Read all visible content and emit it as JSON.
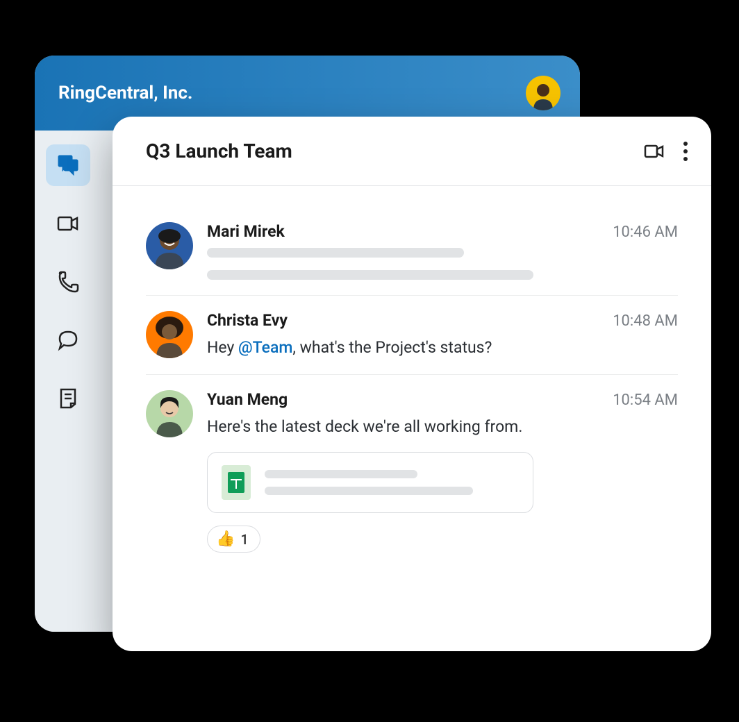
{
  "app": {
    "company": "RingCentral, Inc."
  },
  "chat": {
    "title": "Q3 Launch Team"
  },
  "messages": [
    {
      "author": "Mari Mirek",
      "time": "10:46 AM"
    },
    {
      "author": "Christa Evy",
      "time": "10:48 AM",
      "text_prefix": "Hey ",
      "mention": "@Team",
      "text_suffix": ", what's the Project's status?"
    },
    {
      "author": "Yuan Meng",
      "time": "10:54 AM",
      "text": "Here's the latest deck we're all working from.",
      "reaction_emoji": "👍",
      "reaction_count": "1"
    }
  ]
}
